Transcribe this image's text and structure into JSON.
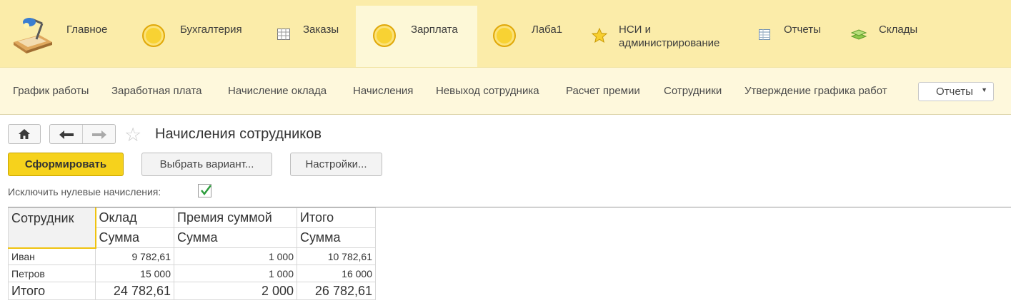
{
  "sections": [
    {
      "label": "Главное",
      "icon": "desk-lamp-icon"
    },
    {
      "label": "Бухгалтерия",
      "icon": "coin-icon"
    },
    {
      "label": "Заказы",
      "icon": "grid-icon"
    },
    {
      "label": "Зарплата",
      "icon": "coin-icon",
      "active": true
    },
    {
      "label": "Лаба1",
      "icon": "coin-icon"
    },
    {
      "label": "НСИ и администрирование",
      "label_line1": "НСИ и",
      "label_line2": "администрирование",
      "icon": "star-icon"
    },
    {
      "label": "Отчеты",
      "icon": "table-icon"
    },
    {
      "label": "Склады",
      "icon": "layers-icon"
    }
  ],
  "functions": [
    "График работы",
    "Заработная плата",
    "Начисление оклада",
    "Начисления",
    "Невыход сотрудника",
    "Расчет премии",
    "Сотрудники",
    "Утверждение графика работ"
  ],
  "reports_menu": "Отчеты",
  "form": {
    "title": "Начисления сотрудников",
    "generate_button": "Сформировать",
    "choose_variant_button": "Выбрать вариант...",
    "settings_button": "Настройки...",
    "exclude_zero_label": "Исключить нулевые начисления:",
    "exclude_zero_checked": true
  },
  "report": {
    "header_col1": "Сотрудник",
    "groups": [
      "Оклад",
      "Премия суммой",
      "Итого"
    ],
    "sub_headers": [
      "Сумма",
      "Сумма",
      "Сумма"
    ],
    "rows": [
      {
        "name": "Иван",
        "values": [
          "9 782,61",
          "1 000",
          "10 782,61"
        ]
      },
      {
        "name": "Петров",
        "values": [
          "15 000",
          "1 000",
          "16 000"
        ]
      }
    ],
    "total": {
      "name": "Итого",
      "values": [
        "24 782,61",
        "2 000",
        "26 782,61"
      ]
    }
  },
  "colors": {
    "sections_bg": "#fbeca9",
    "active_section_bg": "#fdf8d7",
    "functions_bg": "#fef8dc",
    "primary_button": "#f6d21c",
    "selection_border": "#efc310"
  }
}
